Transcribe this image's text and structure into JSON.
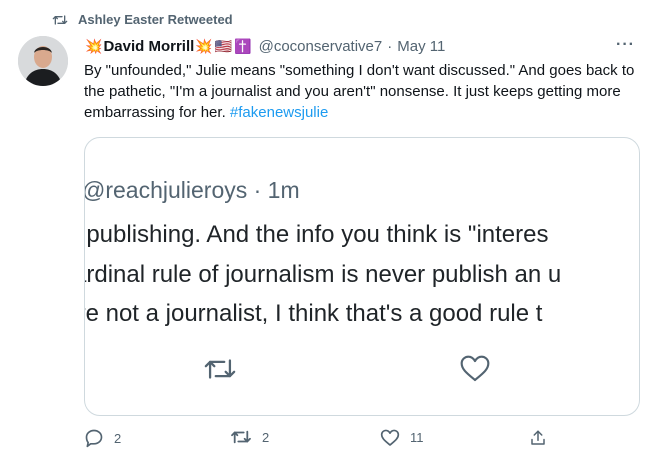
{
  "retweet_banner": {
    "icon": "retweet-icon",
    "text": "Ashley Easter Retweeted"
  },
  "tweet": {
    "author": {
      "name": "David Morrill",
      "emojis_before": [
        "collision-emoji"
      ],
      "emojis_after": [
        "collision-emoji",
        "us-flag-emoji",
        "latin-cross-emoji"
      ],
      "handle": "@coconservative7",
      "avatar": "avatar-photo"
    },
    "separator": "·",
    "date": "May 11",
    "more_icon": "more-icon",
    "more_label": "···",
    "text_main": "By \"unfounded,\" Julie means \"something I don't want discussed.\" And goes back to the pathetic, \"I'm a journalist and you aren't\" nonsense. It just keeps getting more embarrassing for her. ",
    "hashtag": "#fakenewsjulie",
    "media": {
      "header": "@reachjulieroys · 1m",
      "lines": [
        "; publishing. And the info you think is \"interes",
        "ardinal rule of journalism is never publish an u",
        "'re not a journalist, I think that's a good rule t"
      ],
      "icons": [
        "retweet-icon",
        "heart-icon"
      ]
    },
    "actions": {
      "reply": {
        "icon": "reply-icon",
        "count": "2"
      },
      "retweet": {
        "icon": "retweet-icon",
        "count": "2"
      },
      "like": {
        "icon": "heart-icon",
        "count": "11"
      },
      "share": {
        "icon": "share-icon"
      }
    }
  },
  "colors": {
    "accent": "#1d9bf0",
    "secondary_text": "#536471",
    "primary_text": "#0f1419",
    "border": "#cfd9de"
  }
}
